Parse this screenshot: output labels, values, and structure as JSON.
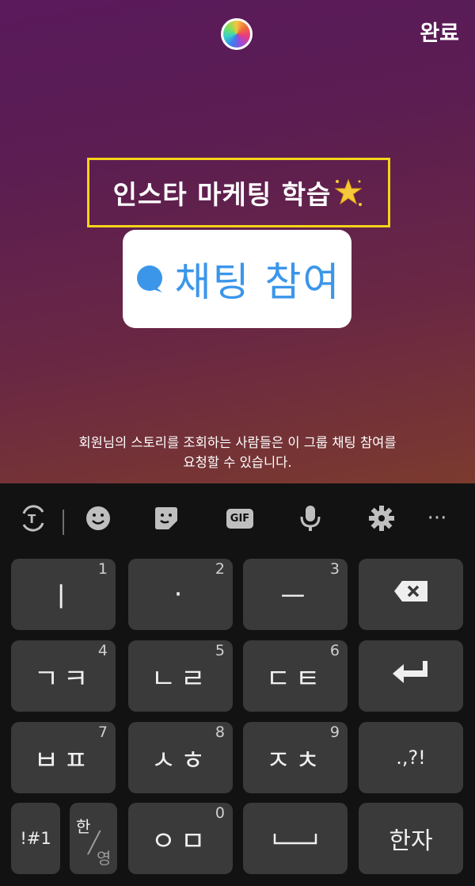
{
  "header": {
    "done_label": "완료",
    "color_picker_icon": "color-wheel-icon"
  },
  "story": {
    "title": "인스타 마케팅 학습",
    "title_emoji": "sparkle-star-icon",
    "sticker_label": "채팅 참여",
    "hint_line1": "회원님의 스토리를 조회하는 사람들은 이 그룹 채팅 참여를",
    "hint_line2": "요청할 수 있습니다."
  },
  "toolbar": {
    "gif_label": "GIF",
    "more_label": "···"
  },
  "keyboard": {
    "rows": [
      [
        {
          "label": "ㅣ",
          "num": "1"
        },
        {
          "label": "·",
          "num": "2"
        },
        {
          "label": "ㅡ",
          "num": "3"
        },
        {
          "label": "⌫",
          "num": ""
        }
      ],
      [
        {
          "label": "ㄱㅋ",
          "num": "4"
        },
        {
          "label": "ㄴㄹ",
          "num": "5"
        },
        {
          "label": "ㄷㅌ",
          "num": "6"
        },
        {
          "label": "↵",
          "num": ""
        }
      ],
      [
        {
          "label": "ㅂㅍ",
          "num": "7"
        },
        {
          "label": "ㅅㅎ",
          "num": "8"
        },
        {
          "label": "ㅈㅊ",
          "num": "9"
        },
        {
          "label": ".,?!",
          "num": ""
        }
      ]
    ],
    "symbols_label": "!#1",
    "lang_top": "한",
    "lang_bottom": "영",
    "zero_label": "ㅇㅁ",
    "zero_num": "0",
    "space_label": "␣",
    "hanja_label": "한자"
  }
}
